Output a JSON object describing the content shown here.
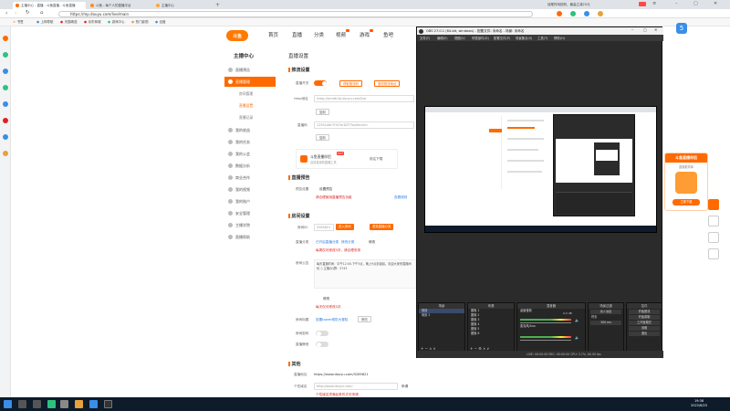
{
  "browser": {
    "tabs": [
      {
        "label": "主播中心 - 直播 - 斗鱼直播 - 斗鱼直播"
      },
      {
        "label": "斗鱼 - 每个人的直播平台"
      },
      {
        "label": "主播中心"
      }
    ],
    "url": "https://mp.douyu.com/live/main",
    "window_title": "烧尾炸鸡抢购，最高立减25元",
    "bookmarks": [
      "书签",
      "上网导航",
      "天猫精选",
      "京东商城",
      "游戏中心",
      "热门影视",
      "百度"
    ]
  },
  "site": {
    "logo": "斗鱼",
    "nav": [
      "首页",
      "直播",
      "分类",
      "视频",
      "游戏",
      "鱼吧"
    ]
  },
  "sidebar": {
    "title": "主播中心",
    "items": [
      {
        "label": "直播预告"
      },
      {
        "label": "直播管理"
      },
      {
        "label": "房间管理"
      },
      {
        "label": "直播设置"
      },
      {
        "label": "直播记录"
      },
      {
        "label": "我的收益"
      },
      {
        "label": "我的任务"
      },
      {
        "label": "我的公会"
      },
      {
        "label": "数据分析"
      },
      {
        "label": "商业合作"
      },
      {
        "label": "我的视频"
      },
      {
        "label": "我的账户"
      },
      {
        "label": "安全管理"
      },
      {
        "label": "主播学院"
      },
      {
        "label": "直播帮助"
      }
    ]
  },
  "main": {
    "page_title": "直播设置",
    "stream": {
      "section": "推流设置",
      "toggle_label": "直播开关",
      "btn_get_code": "获取推流码",
      "btn_copy": "更改推流地址",
      "rtmp_label": "rtmp地址",
      "rtmp_value": "rtmp://sendtc3a.douyu.com/live",
      "btn_copy_rtmp": "复制",
      "key_label": "直播码",
      "key_value": "12951A8cTHCFbrDZT?wsSecret=",
      "btn_copy_key": "复制",
      "tool_title": "斗鱼直播伴侣",
      "tool_sub": "高效易用的直播工具",
      "tool_badge": "HOT",
      "tool_btn": "前往下载"
    },
    "preview": {
      "section": "直播预告",
      "label": "预告设置",
      "btn": "设置预告",
      "hint": "请合理使用直播预告功能",
      "link": "查看规则"
    },
    "room": {
      "section": "房间设置",
      "id_label": "房间ID",
      "id_value": "5285821",
      "btn_wechat": "进入房间",
      "btn_info": "更换直播分类",
      "cat_label": "直播分类",
      "cat_value": "已开启直播分类",
      "cat_link": "修改分类",
      "cat_btn": "修改",
      "cat_hint": "每周仅可修改3次，请合理安排",
      "notice_label": "房间公告",
      "notice_text": "每天直播时间：中午12:00-下午3点，晚上9点到凌晨。欢迎大家来直播间玩 :) 主播QQ群：5743",
      "notice_btn": "修改",
      "notice_hint": "每天仅可修改3次",
      "title_label": "房间标题",
      "title_value": "放置tower塔防大冒险",
      "title_btn": "修改",
      "pw_label": "房间密码",
      "mute_label": "直播静音"
    },
    "other": {
      "section": "其他",
      "share_label": "直播地址",
      "share_value": "https://www.douyu.com/5285821",
      "web_label": "个性域名",
      "web_value": "http://www.douyu.com/",
      "web_btn": "申请",
      "web_hint": "个性域名须满足条件才可申请"
    }
  },
  "obs": {
    "title": "OBS 27.0.1 (64-bit, windows) - 配置文件: 未命名 - 场景: 未命名",
    "menu": [
      "文件(F)",
      "编辑(E)",
      "视图(V)",
      "停靠部件(D)",
      "配置文件(P)",
      "场景集合(S)",
      "工具(T)",
      "帮助(H)"
    ],
    "docks": {
      "scenes": {
        "title": "场景",
        "items": [
          "场景",
          "场景 2"
        ]
      },
      "sources": {
        "title": "来源",
        "items": [
          "图像 1",
          "图像 2",
          "图像 3",
          "图像 4",
          "图像 5",
          "图像 6"
        ]
      },
      "mixer": {
        "title": "混音器",
        "items": [
          "桌面音频",
          "麦克风/Aux"
        ],
        "level": "0.0 dB"
      },
      "transition": {
        "title": "场景过渡",
        "items": [
          "淡入淡出",
          "时长"
        ],
        "duration": "300 ms"
      },
      "controls": {
        "title": "控件",
        "buttons": [
          "开始推流",
          "开始录制",
          "工作室模式",
          "设置",
          "退出"
        ]
      }
    },
    "status": "LIVE: 00:00:00     REC: 00:00:00     CPU: 3.7%, 60.00 fps"
  },
  "assistant": {
    "title": "斗鱼直播伴侣",
    "sub": "直播更简单",
    "btn": "立即下载"
  },
  "taskbar": {
    "time": "19:38",
    "date": "2022/6/25"
  }
}
